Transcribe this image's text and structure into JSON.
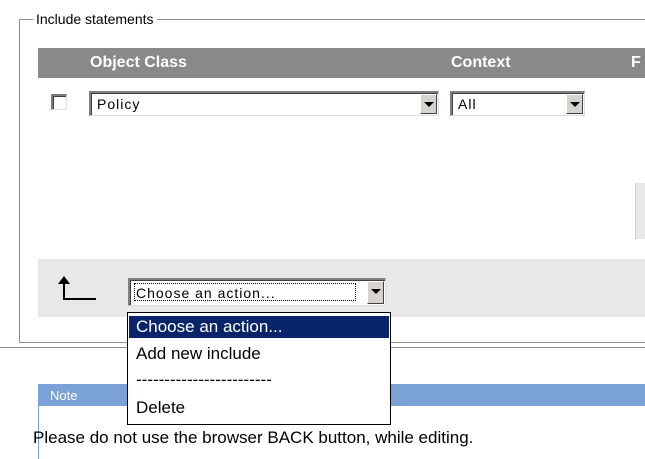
{
  "fieldset": {
    "legend": "Include statements"
  },
  "table": {
    "headers": {
      "object_class": "Object Class",
      "context": "Context",
      "third": "F"
    },
    "row": {
      "checked": false,
      "object_class_value": "Policy",
      "context_value": "All"
    }
  },
  "action_select": {
    "value": "Choose an action...",
    "options": [
      "Choose an action...",
      "Add new include",
      "------------------------",
      "Delete"
    ],
    "selected_index": 0,
    "is_open": true
  },
  "note": {
    "title": "Note",
    "text": "Please do not use the browser BACK button, while editing."
  },
  "colors": {
    "table_header_bg": "#8b8987",
    "action_row_bg": "#e8e8e8",
    "menu_selected_bg": "#0a246a",
    "note_header_bg": "#7ba2d6"
  },
  "icons": {
    "return_arrow": "return-up-arrow-icon",
    "dropdown_arrow": "chevron-down-icon"
  }
}
